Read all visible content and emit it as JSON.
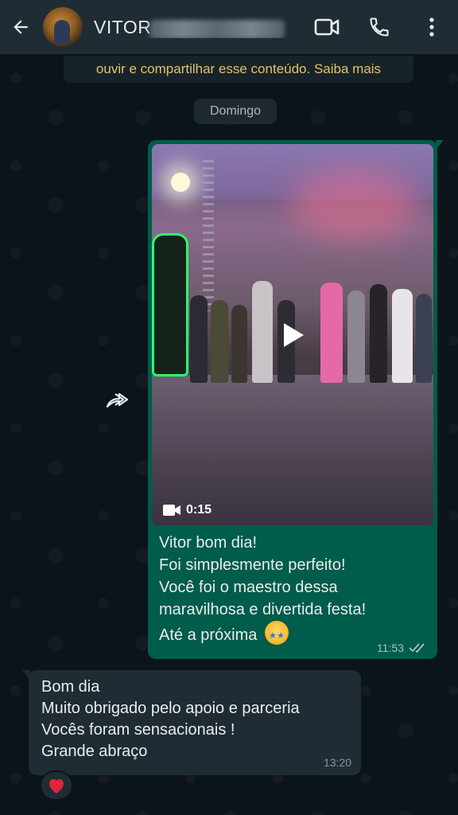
{
  "header": {
    "contact_name": "VITOR",
    "back_icon": "arrow-left-icon",
    "video_call_icon": "video-camera-icon",
    "voice_call_icon": "phone-icon",
    "menu_icon": "more-vertical-icon"
  },
  "chat": {
    "top_notice": "ouvir e compartilhar esse conteúdo. Saiba mais",
    "date_separator": "Domingo",
    "outgoing_message": {
      "video_duration": "0:15",
      "lines": [
        "Vitor bom dia!",
        "Foi simplesmente perfeito!",
        "Você foi o maestro dessa",
        "maravilhosa e divertida festa!",
        "Até a próxima"
      ],
      "emoji": "star-struck-emoji",
      "time": "11:53",
      "status_icon": "double-check-icon"
    },
    "incoming_message": {
      "lines": [
        "Bom dia",
        "Muito obrigado pelo apoio e parceria",
        "Vocês foram sensacionais !",
        "Grande abraço"
      ],
      "time": "13:20",
      "reaction": "red-heart-emoji"
    }
  },
  "colors": {
    "header_bg": "#1f2c34",
    "chat_bg": "#0b141a",
    "outgoing_bubble": "#005c4b",
    "incoming_bubble": "#202c33",
    "notice_text": "#e0c36a",
    "read_ticks": "#a8c4bd"
  }
}
